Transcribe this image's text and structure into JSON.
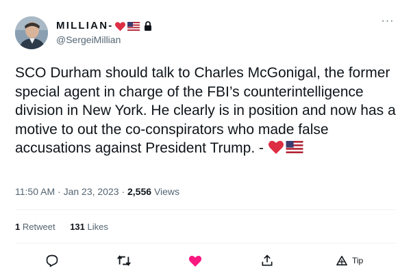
{
  "author": {
    "display_name": "MILLIAN-",
    "handle": "@SergeiMillian",
    "name_emojis": [
      "heart-emoji",
      "us-flag-emoji",
      "lock-icon"
    ]
  },
  "tweet": {
    "text": "SCO Durham should talk to Charles McGonigal, the former special agent in charge of the FBI’s counterintelligence division in New York. He clearly is in position and now has a motive to out the co-conspirators who made false accusations against President Trump. - ",
    "trailing_emojis": [
      "heart-emoji",
      "us-flag-emoji"
    ]
  },
  "meta": {
    "time": "11:50 AM",
    "date": "Jan 23, 2023",
    "separator": "·",
    "views_count": "2,556",
    "views_label": "Views"
  },
  "stats": {
    "retweets_count": "1",
    "retweets_label": "Retweet",
    "likes_count": "131",
    "likes_label": "Likes"
  },
  "actions": {
    "reply_icon": "reply-icon",
    "retweet_icon": "retweet-icon",
    "like_icon": "heart-icon",
    "share_icon": "share-icon",
    "tip_icon": "tip-icon",
    "tip_label": "Tip"
  },
  "colors": {
    "text": "#0f1419",
    "secondary": "#536471",
    "heart": "#f91880",
    "emoji_heart": "#dd2e44",
    "divider": "#eff3f4"
  }
}
